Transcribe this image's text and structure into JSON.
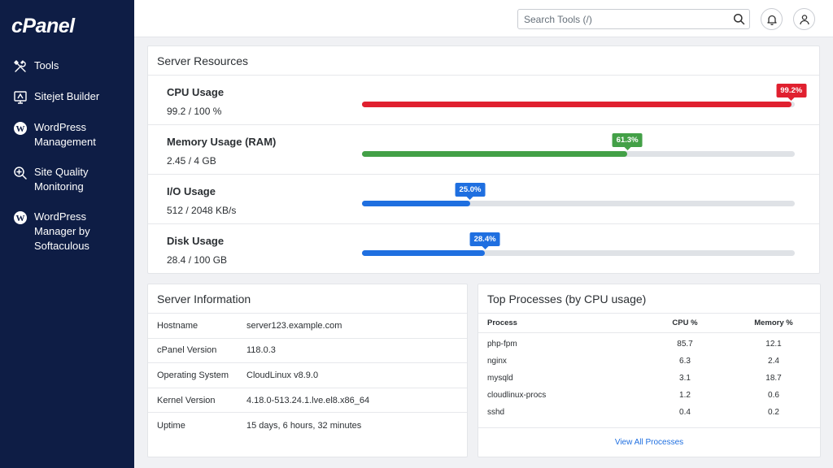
{
  "sidebar": {
    "logo": "cPanel",
    "items": [
      {
        "icon": "tools-icon",
        "label": "Tools"
      },
      {
        "icon": "sitejet-icon",
        "label": "Sitejet Builder"
      },
      {
        "icon": "wordpress-icon",
        "label": "WordPress Management"
      },
      {
        "icon": "magnifier-plus-icon",
        "label": "Site Quality Monitoring"
      },
      {
        "icon": "wordpress-icon",
        "label": "WordPress Manager by Softaculous"
      }
    ]
  },
  "header": {
    "search_placeholder": "Search Tools (/)",
    "icons": [
      "search-icon",
      "bell-icon",
      "user-icon"
    ]
  },
  "resources": {
    "title": "Server Resources",
    "rows": [
      {
        "label": "CPU Usage",
        "value": "99.2 / 100 %",
        "percent": 99.2,
        "percent_label": "99.2%",
        "color": "#e0202f"
      },
      {
        "label": "Memory Usage (RAM)",
        "value": "2.45 / 4 GB",
        "percent": 61.3,
        "percent_label": "61.3%",
        "color": "#43a047"
      },
      {
        "label": "I/O Usage",
        "value": "512 / 2048 KB/s",
        "percent": 25.0,
        "percent_label": "25.0%",
        "color": "#1f6fe0"
      },
      {
        "label": "Disk Usage",
        "value": "28.4 / 100 GB",
        "percent": 28.4,
        "percent_label": "28.4%",
        "color": "#1f6fe0"
      }
    ]
  },
  "server_info": {
    "title": "Server Information",
    "rows": [
      {
        "key": "Hostname",
        "value": "server123.example.com"
      },
      {
        "key": "cPanel Version",
        "value": "118.0.3"
      },
      {
        "key": "Operating System",
        "value": "CloudLinux v8.9.0"
      },
      {
        "key": "Kernel Version",
        "value": "4.18.0-513.24.1.lve.el8.x86_64"
      },
      {
        "key": "Uptime",
        "value": "15 days, 6 hours, 32 minutes"
      }
    ]
  },
  "processes": {
    "title": "Top Processes (by CPU usage)",
    "columns": [
      "Process",
      "CPU %",
      "Memory %"
    ],
    "rows": [
      {
        "name": "php-fpm",
        "cpu": "85.7",
        "mem": "12.1"
      },
      {
        "name": "nginx",
        "cpu": "6.3",
        "mem": "2.4"
      },
      {
        "name": "mysqld",
        "cpu": "3.1",
        "mem": "18.7"
      },
      {
        "name": "cloudlinux-procs",
        "cpu": "1.2",
        "mem": "0.6"
      },
      {
        "name": "sshd",
        "cpu": "0.4",
        "mem": "0.2"
      }
    ],
    "footer_link": "View All Processes"
  }
}
